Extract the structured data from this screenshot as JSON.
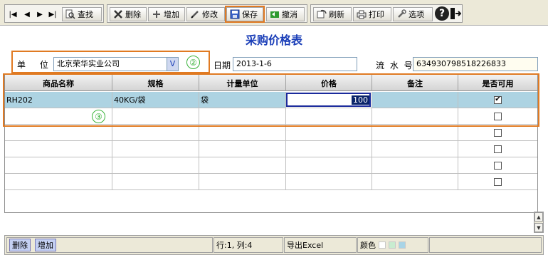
{
  "toolbar": {
    "find": "查找",
    "delete": "删除",
    "add": "增加",
    "edit": "修改",
    "save": "保存",
    "cancel": "撤消",
    "refresh": "刷新",
    "print": "打印",
    "options": "选项",
    "help_glyph": "?",
    "nav_glyphs": [
      "|◀",
      "◀",
      "▶",
      "▶|"
    ]
  },
  "title": "采购价格表",
  "form": {
    "unit_label": "单 位",
    "unit_value": "北京荣华实业公司",
    "combo_glyph": "V",
    "date_label": "日期",
    "date_value": "2013-1-6",
    "serial_label": "流 水 号",
    "serial_value": "634930798518226833"
  },
  "annotations": {
    "two": "②",
    "three": "③"
  },
  "grid": {
    "columns": [
      "商品名称",
      "规格",
      "计量单位",
      "价格",
      "备注",
      "是否可用"
    ],
    "rows": [
      {
        "name": "RH202",
        "spec": "40KG/袋",
        "unit": "袋",
        "price": "100",
        "note": "",
        "enabled": "✔"
      },
      {
        "name": "",
        "spec": "",
        "unit": "",
        "price": "",
        "note": "",
        "enabled": ""
      },
      {
        "name": "",
        "spec": "",
        "unit": "",
        "price": "",
        "note": "",
        "enabled": ""
      },
      {
        "name": "",
        "spec": "",
        "unit": "",
        "price": "",
        "note": "",
        "enabled": ""
      },
      {
        "name": "",
        "spec": "",
        "unit": "",
        "price": "",
        "note": "",
        "enabled": ""
      },
      {
        "name": "",
        "spec": "",
        "unit": "",
        "price": "",
        "note": "",
        "enabled": ""
      }
    ]
  },
  "status": {
    "delete_btn": "删除",
    "add_btn": "增加",
    "position": "行:1, 列:4",
    "export": "导出Excel",
    "color_label": "颜色"
  },
  "colors": {
    "accent_orange": "#e07a22",
    "title_blue": "#1b3fb8",
    "row_selected": "#add3e2",
    "annotation_green": "#38b238",
    "swatches": [
      "#ffffff",
      "#c8ecd0",
      "#a8d4e6"
    ]
  }
}
